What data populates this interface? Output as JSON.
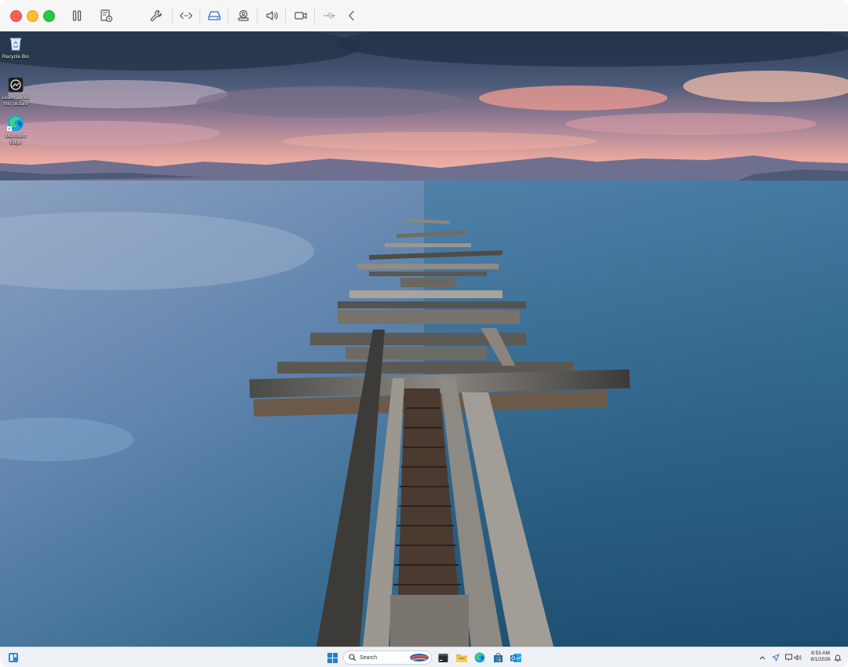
{
  "host_toolbar": {
    "buttons": [
      {
        "name": "pause",
        "icon": "pause-icon"
      },
      {
        "name": "snapshot",
        "icon": "snapshot-icon"
      },
      {
        "name": "settings",
        "icon": "wrench-icon"
      },
      {
        "name": "network",
        "icon": "code-arrows-icon"
      },
      {
        "name": "disk",
        "icon": "hard-drive-icon",
        "active": true
      },
      {
        "name": "user",
        "icon": "shared-folder-icon"
      },
      {
        "name": "sound",
        "icon": "speaker-icon"
      },
      {
        "name": "camera",
        "icon": "camera-icon"
      },
      {
        "name": "usb",
        "icon": "usb-icon"
      },
      {
        "name": "collapse",
        "icon": "chevron-left-icon"
      }
    ],
    "accent_color": "#2f6fe0"
  },
  "desktop": {
    "icons": [
      {
        "label": "Recycle Bin",
        "icon": "recycle-bin-icon"
      },
      {
        "label": "Learn about this picture",
        "icon": "learn-picture-icon"
      },
      {
        "label": "Microsoft Edge",
        "icon": "edge-icon"
      }
    ]
  },
  "taskbar": {
    "search_label": "Search",
    "pinned": [
      "start-icon",
      "search-highlight-icon",
      "terminal-icon",
      "file-explorer-icon",
      "edge-icon",
      "store-icon",
      "outlook-icon"
    ],
    "tray": {
      "time": "8:53 AM",
      "date": "8/1/2026"
    }
  }
}
